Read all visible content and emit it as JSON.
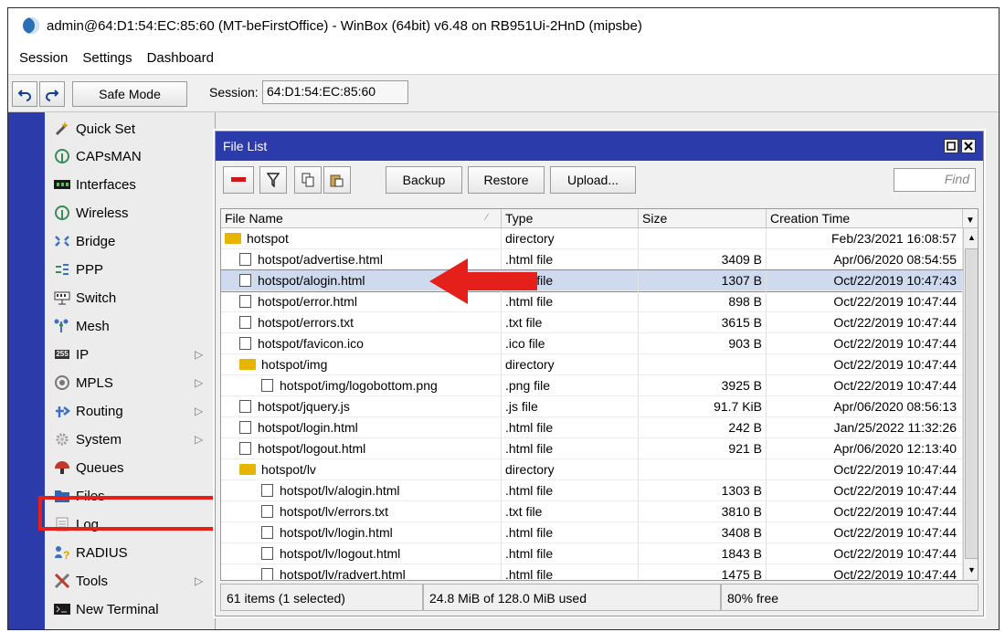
{
  "window_title": "admin@64:D1:54:EC:85:60 (MT-beFirstOffice) - WinBox (64bit) v6.48 on RB951Ui-2HnD (mipsbe)",
  "menu": [
    "Session",
    "Settings",
    "Dashboard"
  ],
  "toolbar": {
    "safe_mode": "Safe Mode",
    "session_label": "Session:",
    "session_value": "64:D1:54:EC:85:60"
  },
  "sidebar": {
    "items": [
      {
        "label": "Quick Set",
        "icon": "wand-icon",
        "submenu": false
      },
      {
        "label": "CAPsMAN",
        "icon": "antenna-icon",
        "submenu": false
      },
      {
        "label": "Interfaces",
        "icon": "ethernet-icon",
        "submenu": false
      },
      {
        "label": "Wireless",
        "icon": "wireless-icon",
        "submenu": false
      },
      {
        "label": "Bridge",
        "icon": "bridge-icon",
        "submenu": false
      },
      {
        "label": "PPP",
        "icon": "ppp-icon",
        "submenu": false
      },
      {
        "label": "Switch",
        "icon": "switch-icon",
        "submenu": false
      },
      {
        "label": "Mesh",
        "icon": "mesh-icon",
        "submenu": false
      },
      {
        "label": "IP",
        "icon": "ip-icon",
        "icon_text": "255",
        "submenu": true
      },
      {
        "label": "MPLS",
        "icon": "mpls-icon",
        "submenu": true
      },
      {
        "label": "Routing",
        "icon": "routing-icon",
        "submenu": true
      },
      {
        "label": "System",
        "icon": "gear-icon",
        "submenu": true
      },
      {
        "label": "Queues",
        "icon": "queues-icon",
        "submenu": false
      },
      {
        "label": "Files",
        "icon": "folder-icon",
        "submenu": false
      },
      {
        "label": "Log",
        "icon": "log-icon",
        "submenu": false
      },
      {
        "label": "RADIUS",
        "icon": "radius-icon",
        "submenu": false
      },
      {
        "label": "Tools",
        "icon": "tools-icon",
        "submenu": true
      },
      {
        "label": "New Terminal",
        "icon": "terminal-icon",
        "submenu": false
      }
    ]
  },
  "file_list": {
    "title": "File List",
    "buttons": {
      "backup": "Backup",
      "restore": "Restore",
      "upload": "Upload..."
    },
    "find_placeholder": "Find",
    "columns": [
      "File Name",
      "Type",
      "Size",
      "Creation Time"
    ],
    "rows": [
      {
        "name": "hotspot",
        "type": "directory",
        "size": "",
        "time": "Feb/23/2021 16:08:57",
        "kind": "folder",
        "indent": 0
      },
      {
        "name": "hotspot/advertise.html",
        "type": ".html file",
        "size": "3409 B",
        "time": "Apr/06/2020 08:54:55",
        "kind": "file",
        "indent": 1
      },
      {
        "name": "hotspot/alogin.html",
        "type": ".html file",
        "size": "1307 B",
        "time": "Oct/22/2019 10:47:43",
        "kind": "file",
        "indent": 1,
        "selected": true
      },
      {
        "name": "hotspot/error.html",
        "type": ".html file",
        "size": "898 B",
        "time": "Oct/22/2019 10:47:44",
        "kind": "file",
        "indent": 1
      },
      {
        "name": "hotspot/errors.txt",
        "type": ".txt file",
        "size": "3615 B",
        "time": "Oct/22/2019 10:47:44",
        "kind": "file",
        "indent": 1
      },
      {
        "name": "hotspot/favicon.ico",
        "type": ".ico file",
        "size": "903 B",
        "time": "Oct/22/2019 10:47:44",
        "kind": "file",
        "indent": 1
      },
      {
        "name": "hotspot/img",
        "type": "directory",
        "size": "",
        "time": "Oct/22/2019 10:47:44",
        "kind": "folder",
        "indent": 1
      },
      {
        "name": "hotspot/img/logobottom.png",
        "type": ".png file",
        "size": "3925 B",
        "time": "Oct/22/2019 10:47:44",
        "kind": "file",
        "indent": 2
      },
      {
        "name": "hotspot/jquery.js",
        "type": ".js file",
        "size": "91.7 KiB",
        "time": "Apr/06/2020 08:56:13",
        "kind": "file",
        "indent": 1
      },
      {
        "name": "hotspot/login.html",
        "type": ".html file",
        "size": "242 B",
        "time": "Jan/25/2022 11:32:26",
        "kind": "file",
        "indent": 1
      },
      {
        "name": "hotspot/logout.html",
        "type": ".html file",
        "size": "921 B",
        "time": "Apr/06/2020 12:13:40",
        "kind": "file",
        "indent": 1
      },
      {
        "name": "hotspot/lv",
        "type": "directory",
        "size": "",
        "time": "Oct/22/2019 10:47:44",
        "kind": "folder",
        "indent": 1
      },
      {
        "name": "hotspot/lv/alogin.html",
        "type": ".html file",
        "size": "1303 B",
        "time": "Oct/22/2019 10:47:44",
        "kind": "file",
        "indent": 2
      },
      {
        "name": "hotspot/lv/errors.txt",
        "type": ".txt file",
        "size": "3810 B",
        "time": "Oct/22/2019 10:47:44",
        "kind": "file",
        "indent": 2
      },
      {
        "name": "hotspot/lv/login.html",
        "type": ".html file",
        "size": "3408 B",
        "time": "Oct/22/2019 10:47:44",
        "kind": "file",
        "indent": 2
      },
      {
        "name": "hotspot/lv/logout.html",
        "type": ".html file",
        "size": "1843 B",
        "time": "Oct/22/2019 10:47:44",
        "kind": "file",
        "indent": 2
      },
      {
        "name": "hotspot/lv/radvert.html",
        "type": ".html file",
        "size": "1475 B",
        "time": "Oct/22/2019 10:47:44",
        "kind": "file",
        "indent": 2
      }
    ],
    "status": {
      "items": "61 items (1 selected)",
      "used": "24.8 MiB of 128.0 MiB used",
      "free": "80% free"
    }
  },
  "colors": {
    "accent": "#2c3baa",
    "highlight_red": "#e5201a",
    "folder": "#e7b400"
  }
}
